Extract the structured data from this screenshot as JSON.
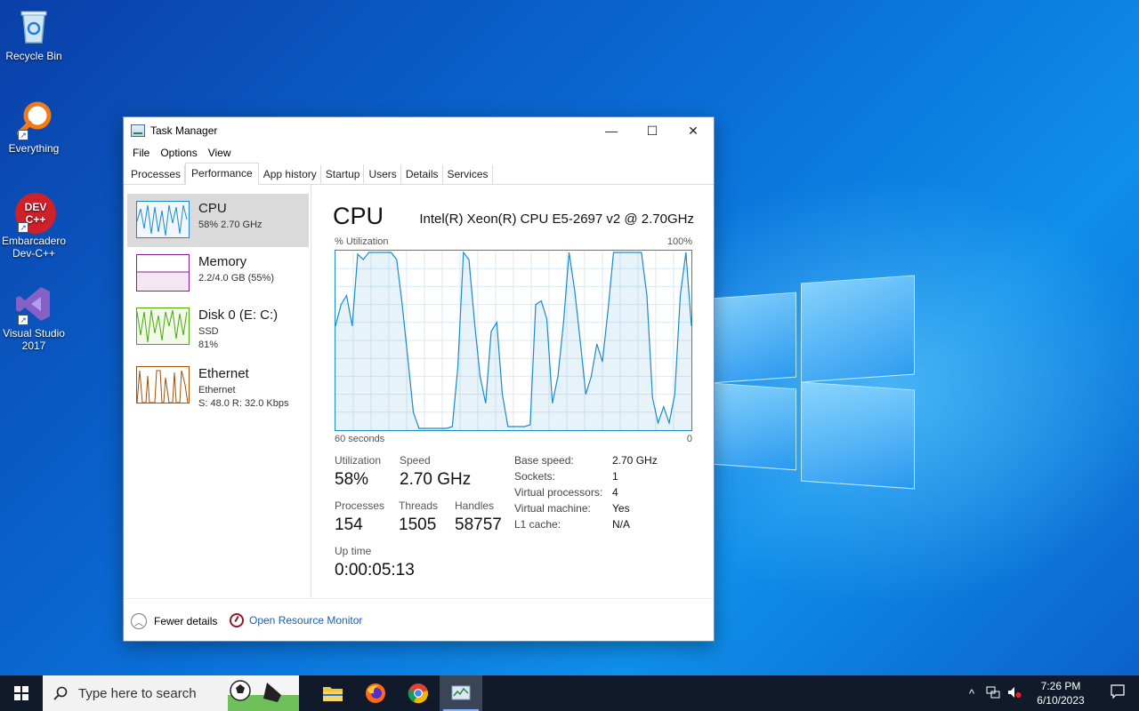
{
  "desktop": {
    "icons": [
      {
        "label": "Recycle Bin"
      },
      {
        "label": "Everything"
      },
      {
        "label": "Embarcadero Dev-C++"
      },
      {
        "label": "Visual Studio 2017"
      }
    ],
    "devcpp_logo": "DEV C++"
  },
  "window": {
    "title": "Task Manager",
    "controls": {
      "minimize": "—",
      "maximize": "☐",
      "close": "✕"
    },
    "menu": [
      "File",
      "Options",
      "View"
    ],
    "tabs": [
      "Processes",
      "Performance",
      "App history",
      "Startup",
      "Users",
      "Details",
      "Services"
    ],
    "active_tab": "Performance"
  },
  "sidebar": {
    "items": [
      {
        "name": "CPU",
        "sub1": "58% 2.70 GHz",
        "sub2": "",
        "color": "#1b8bc8"
      },
      {
        "name": "Memory",
        "sub1": "2.2/4.0 GB (55%)",
        "sub2": "",
        "color": "#8b1f8f"
      },
      {
        "name": "Disk 0 (E: C:)",
        "sub1": "SSD",
        "sub2": "81%",
        "color": "#4da80a"
      },
      {
        "name": "Ethernet",
        "sub1": "Ethernet",
        "sub2": "S: 48.0  R: 32.0 Kbps",
        "color": "#a74f01"
      }
    ]
  },
  "cpu_panel": {
    "title": "CPU",
    "model": "Intel(R) Xeon(R) CPU E5-2697 v2 @ 2.70GHz",
    "graph_label_left": "% Utilization",
    "graph_label_right": "100%",
    "axis_left": "60 seconds",
    "axis_right": "0",
    "graph_series": [
      58,
      70,
      75,
      58,
      98,
      95,
      99,
      99,
      99,
      99,
      99,
      95,
      70,
      40,
      10,
      1,
      1,
      1,
      1,
      1,
      1,
      2,
      35,
      99,
      95,
      60,
      30,
      15,
      55,
      60,
      20,
      2,
      2,
      2,
      2,
      3,
      70,
      72,
      62,
      15,
      30,
      60,
      99,
      78,
      50,
      20,
      30,
      48,
      38,
      67,
      99,
      99,
      99,
      99,
      99,
      99,
      75,
      18,
      4,
      13,
      4,
      20,
      75,
      99,
      58
    ],
    "stats": {
      "utilization_label": "Utilization",
      "utilization": "58%",
      "speed_label": "Speed",
      "speed": "2.70 GHz",
      "processes_label": "Processes",
      "processes": "154",
      "threads_label": "Threads",
      "threads": "1505",
      "handles_label": "Handles",
      "handles": "58757",
      "uptime_label": "Up time",
      "uptime": "0:00:05:13"
    },
    "details": [
      {
        "k": "Base speed:",
        "v": "2.70 GHz"
      },
      {
        "k": "Sockets:",
        "v": "1"
      },
      {
        "k": "Virtual processors:",
        "v": "4"
      },
      {
        "k": "Virtual machine:",
        "v": "Yes"
      },
      {
        "k": "L1 cache:",
        "v": "N/A"
      }
    ]
  },
  "footer": {
    "fewer": "Fewer details",
    "resmon": "Open Resource Monitor"
  },
  "taskbar": {
    "search_placeholder": "Type here to search",
    "time": "7:26 PM",
    "date": "6/10/2023"
  },
  "colors": {
    "accent": "#1b8bc8",
    "taskbar": "#101a2a"
  }
}
